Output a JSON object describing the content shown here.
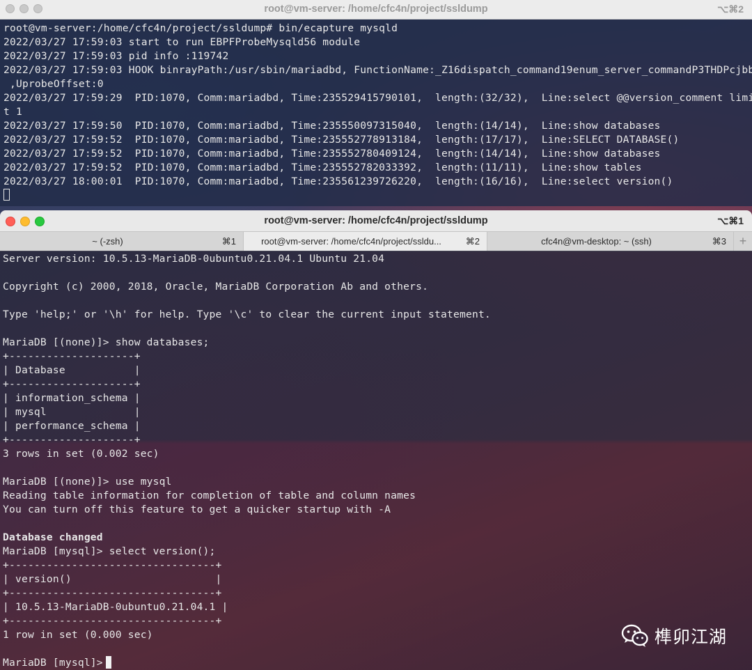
{
  "window1": {
    "title": "root@vm-server: /home/cfc4n/project/ssldump",
    "shortcut": "⌥⌘2",
    "lines": [
      "root@vm-server:/home/cfc4n/project/ssldump# bin/ecapture mysqld",
      "2022/03/27 17:59:03 start to run EBPFProbeMysqld56 module",
      "2022/03/27 17:59:03 pid info :119742",
      "2022/03/27 17:59:03 HOOK binrayPath:/usr/sbin/mariadbd, FunctionName:_Z16dispatch_command19enum_server_commandP3THDPcjbb",
      " ,UprobeOffset:0",
      "2022/03/27 17:59:29  PID:1070, Comm:mariadbd, Time:235529415790101,  length:(32/32),  Line:select @@version_comment limi",
      "t 1",
      "2022/03/27 17:59:50  PID:1070, Comm:mariadbd, Time:235550097315040,  length:(14/14),  Line:show databases",
      "2022/03/27 17:59:52  PID:1070, Comm:mariadbd, Time:235552778913184,  length:(17/17),  Line:SELECT DATABASE()",
      "2022/03/27 17:59:52  PID:1070, Comm:mariadbd, Time:235552780409124,  length:(14/14),  Line:show databases",
      "2022/03/27 17:59:52  PID:1070, Comm:mariadbd, Time:235552782033392,  length:(11/11),  Line:show tables",
      "2022/03/27 18:00:01  PID:1070, Comm:mariadbd, Time:235561239726220,  length:(16/16),  Line:select version()"
    ]
  },
  "window2": {
    "title": "root@vm-server: /home/cfc4n/project/ssldump",
    "shortcut": "⌥⌘1",
    "tabs": [
      {
        "label": "~ (-zsh)",
        "key": "⌘1"
      },
      {
        "label": "root@vm-server: /home/cfc4n/project/ssldu...",
        "key": "⌘2"
      },
      {
        "label": "cfc4n@vm-desktop: ~ (ssh)",
        "key": "⌘3"
      }
    ],
    "add_tab": "+",
    "lines": [
      "Server version: 10.5.13-MariaDB-0ubuntu0.21.04.1 Ubuntu 21.04",
      "",
      "Copyright (c) 2000, 2018, Oracle, MariaDB Corporation Ab and others.",
      "",
      "Type 'help;' or '\\h' for help. Type '\\c' to clear the current input statement.",
      "",
      "MariaDB [(none)]> show databases;",
      "+--------------------+",
      "| Database           |",
      "+--------------------+",
      "| information_schema |",
      "| mysql              |",
      "| performance_schema |",
      "+--------------------+",
      "3 rows in set (0.002 sec)",
      "",
      "MariaDB [(none)]> use mysql",
      "Reading table information for completion of table and column names",
      "You can turn off this feature to get a quicker startup with -A",
      "",
      "Database changed",
      "MariaDB [mysql]> select version();",
      "+---------------------------------+",
      "| version()                       |",
      "+---------------------------------+",
      "| 10.5.13-MariaDB-0ubuntu0.21.04.1 |",
      "+---------------------------------+",
      "1 row in set (0.000 sec)",
      ""
    ],
    "prompt": "MariaDB [mysql]>"
  },
  "watermark": {
    "text": "榫卯江湖",
    "icon": "wechat-icon"
  }
}
